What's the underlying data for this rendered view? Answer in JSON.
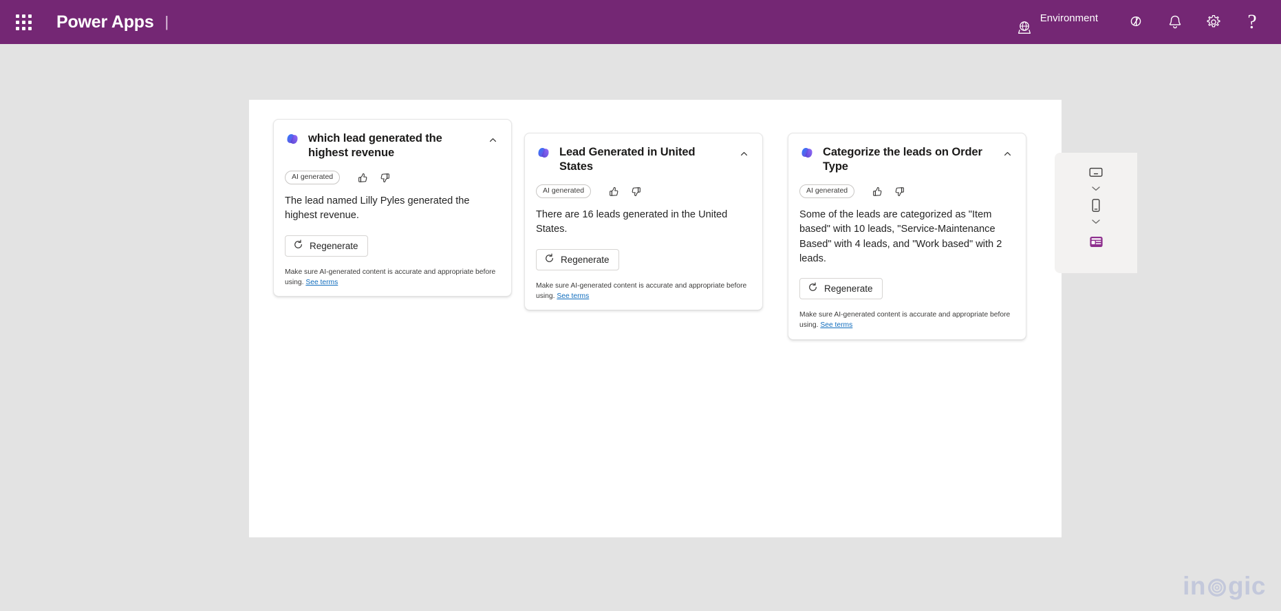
{
  "header": {
    "waffle_icon": "app-launcher-waffle-icon",
    "brand": "Power Apps",
    "divider": "|",
    "environment": {
      "icon": "environment-globe-icon",
      "label": "Environment"
    },
    "icons": [
      {
        "name": "copilot-ribbon-icon",
        "label": "Copilot"
      },
      {
        "name": "bell-icon",
        "label": "Notifications"
      },
      {
        "name": "gear-icon",
        "label": "Settings"
      },
      {
        "name": "question-mark-icon",
        "label": "?"
      }
    ]
  },
  "colors": {
    "brand_purple": "#742774",
    "page_background": "#e3e3e3",
    "canvas": "#ffffff",
    "link_blue": "#0f6cbd",
    "panel_gray": "#f3f2f1",
    "active_purple": "#8e2f8e",
    "watermark": "#c3c8db"
  },
  "cards": [
    {
      "copilot_icon": "copilot-icon",
      "title": "which lead generated the highest revenue",
      "ai_badge": "AI generated",
      "thumbs_up_icon": "thumbs-up-icon",
      "thumbs_down_icon": "thumbs-down-icon",
      "collapse_icon": "chevron-up-icon",
      "body": "The lead named Lilly Pyles generated the highest revenue.",
      "regenerate_label": "Regenerate",
      "regenerate_icon": "refresh-icon",
      "disclaimer": "Make sure AI-generated content is accurate and appropriate before using. ",
      "terms_link": "See terms"
    },
    {
      "copilot_icon": "copilot-icon",
      "title": "Lead Generated in United States",
      "ai_badge": "AI generated",
      "thumbs_up_icon": "thumbs-up-icon",
      "thumbs_down_icon": "thumbs-down-icon",
      "collapse_icon": "chevron-up-icon",
      "body": "There are 16 leads generated in the United States.",
      "regenerate_label": "Regenerate",
      "regenerate_icon": "refresh-icon",
      "disclaimer": "Make sure AI-generated content is accurate and appropriate before using. ",
      "terms_link": "See terms"
    },
    {
      "copilot_icon": "copilot-icon",
      "title": "Categorize the leads on Order Type",
      "ai_badge": "AI generated",
      "thumbs_up_icon": "thumbs-up-icon",
      "thumbs_down_icon": "thumbs-down-icon",
      "collapse_icon": "chevron-up-icon",
      "body": "Some of the leads are categorized as \"Item based\" with 10 leads, \"Service-Maintenance Based\" with 4 leads, and \"Work based\" with 2 leads.",
      "regenerate_label": "Regenerate",
      "regenerate_icon": "refresh-icon",
      "disclaimer": "Make sure AI-generated content is accurate and appropriate before using. ",
      "terms_link": "See terms"
    }
  ],
  "device_panel": {
    "items": [
      {
        "name": "desktop-monitor-icon",
        "label": "Desktop"
      },
      {
        "name": "chevron-down-icon",
        "label": "Expand desktop sizes"
      },
      {
        "name": "mobile-phone-icon",
        "label": "Phone"
      },
      {
        "name": "chevron-down-icon",
        "label": "Expand phone sizes"
      },
      {
        "name": "form-card-icon",
        "label": "Card"
      }
    ]
  },
  "watermark": {
    "text_before": "in",
    "text_after": "gic"
  }
}
